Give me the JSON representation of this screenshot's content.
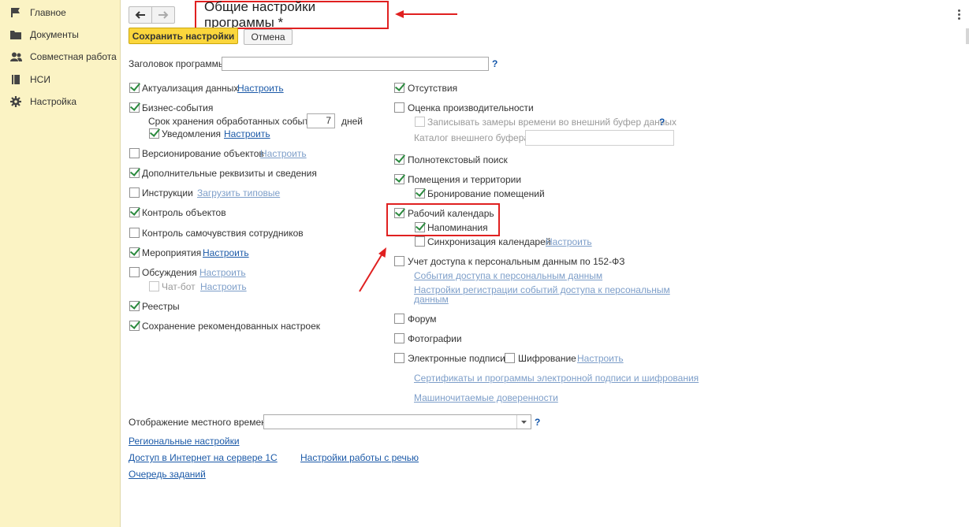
{
  "sidebar": {
    "items": [
      {
        "label": "Главное",
        "icon": "flag-icon"
      },
      {
        "label": "Документы",
        "icon": "folder-icon"
      },
      {
        "label": "Совместная работа",
        "icon": "users-icon"
      },
      {
        "label": "НСИ",
        "icon": "book-icon"
      },
      {
        "label": "Настройка",
        "icon": "gear-icon"
      }
    ]
  },
  "header": {
    "title": "Общие настройки программы *",
    "save_label": "Сохранить настройки",
    "cancel_label": "Отмена"
  },
  "program_title": {
    "label": "Заголовок программы:",
    "value": "",
    "help": "?"
  },
  "left_column": {
    "data_update": {
      "label": "Актуализация данных",
      "checked": true,
      "link": "Настроить"
    },
    "business_events": {
      "label": "Бизнес-события",
      "checked": true
    },
    "retention": {
      "label": "Срок хранения обработанных событий:",
      "value": "7",
      "unit": "дней"
    },
    "notifications": {
      "label": "Уведомления",
      "checked": true,
      "link": "Настроить"
    },
    "versioning": {
      "label": "Версионирование объектов",
      "checked": false,
      "link": "Настроить"
    },
    "extra_attributes": {
      "label": "Дополнительные реквизиты и сведения",
      "checked": true
    },
    "instructions": {
      "label": "Инструкции",
      "checked": false,
      "link": "Загрузить типовые"
    },
    "object_control": {
      "label": "Контроль объектов",
      "checked": true
    },
    "wellbeing": {
      "label": "Контроль самочувствия сотрудников",
      "checked": false
    },
    "events": {
      "label": "Мероприятия",
      "checked": true,
      "link": "Настроить"
    },
    "discussions": {
      "label": "Обсуждения",
      "checked": false,
      "link": "Настроить"
    },
    "chatbot": {
      "label": "Чат-бот",
      "checked": false,
      "link": "Настроить"
    },
    "registers": {
      "label": "Реестры",
      "checked": true
    },
    "saved_settings": {
      "label": "Сохранение рекомендованных настроек",
      "checked": true
    }
  },
  "right_column": {
    "absences": {
      "label": "Отсутствия",
      "checked": true
    },
    "performance": {
      "label": "Оценка производительности",
      "checked": false
    },
    "write_measurements": {
      "label": "Записывать замеры времени во внешний буфер данных",
      "checked": false,
      "help": "?"
    },
    "buffer_catalog": {
      "label": "Каталог внешнего буфера:",
      "value": ""
    },
    "fulltext": {
      "label": "Полнотекстовый поиск",
      "checked": true
    },
    "premises": {
      "label": "Помещения и территории",
      "checked": true
    },
    "booking": {
      "label": "Бронирование помещений",
      "checked": true
    },
    "work_calendar": {
      "label": "Рабочий календарь",
      "checked": true
    },
    "reminders": {
      "label": "Напоминания",
      "checked": true
    },
    "calendar_sync": {
      "label": "Синхронизация календарей",
      "checked": false,
      "link": "Настроить"
    },
    "personal_data": {
      "label": "Учет доступа к персональным данным по 152-ФЗ",
      "checked": false
    },
    "pd_events_link": "События доступа к персональным данным",
    "pd_settings_link_line1": "Настройки регистрации событий доступа к персональным",
    "pd_settings_link_line2": "данным",
    "forum": {
      "label": "Форум",
      "checked": false
    },
    "photos": {
      "label": "Фотографии",
      "checked": false
    },
    "esign": {
      "label": "Электронные подписи",
      "checked": false
    },
    "encryption": {
      "label": "Шифрование",
      "checked": false,
      "link": "Настроить"
    },
    "certs_link": "Сертификаты и программы электронной подписи и шифрования",
    "poa_link": "Машиночитаемые доверенности"
  },
  "bottom": {
    "local_time": {
      "label": "Отображение местного времени:",
      "value": "",
      "help": "?"
    },
    "regional_link": "Региональные настройки",
    "internet_link": "Доступ в Интернет на сервере 1С",
    "speech_link": "Настройки работы с речью",
    "jobs_link": "Очередь заданий"
  },
  "colors": {
    "sidebar_bg": "#fbf3c4",
    "accent": "#fbd63c",
    "link": "#1c5aa8",
    "annotation": "#e02020",
    "check": "#2b8a3e"
  }
}
